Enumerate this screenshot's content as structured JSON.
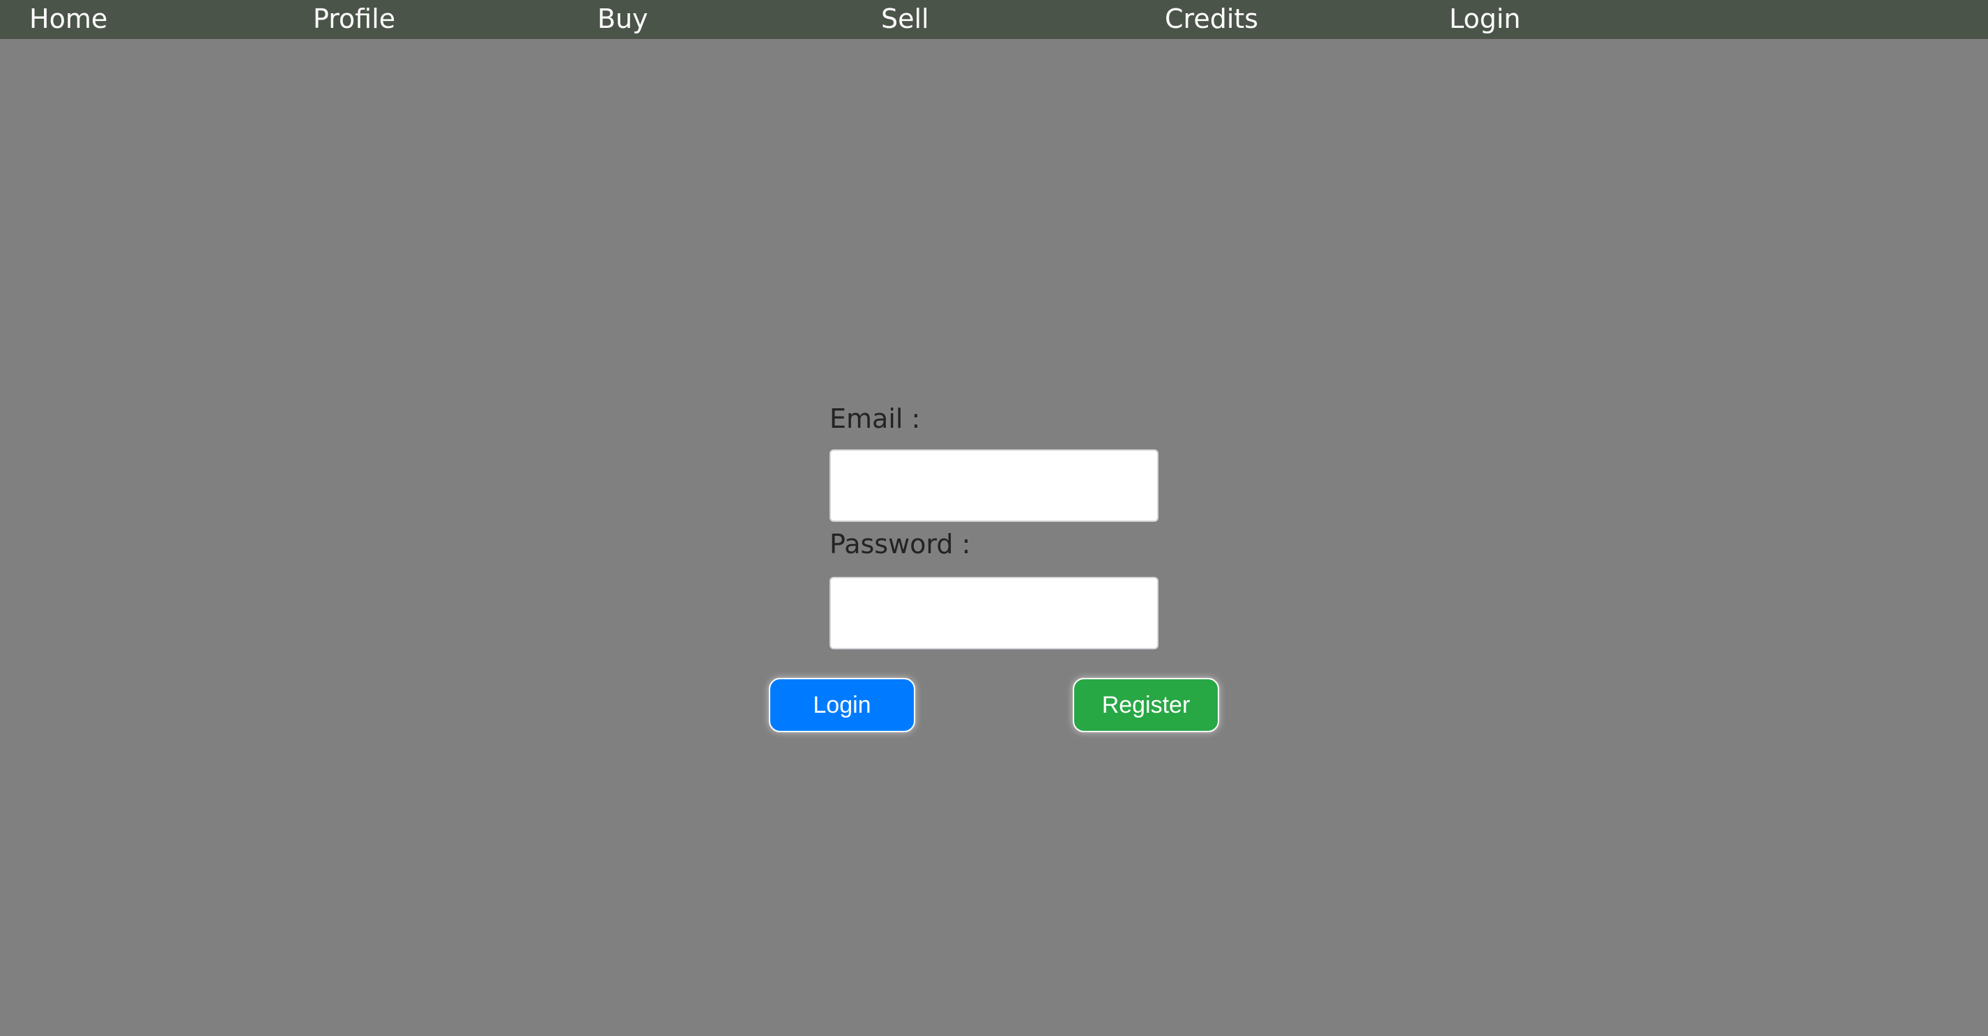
{
  "nav": {
    "items": [
      {
        "label": "Home"
      },
      {
        "label": "Profile"
      },
      {
        "label": "Buy"
      },
      {
        "label": "Sell"
      },
      {
        "label": "Credits"
      },
      {
        "label": "Login"
      }
    ]
  },
  "form": {
    "email_label": "Email :",
    "email_value": "",
    "password_label": "Password :",
    "password_value": "",
    "login_button": "Login",
    "register_button": "Register"
  },
  "colors": {
    "page_background": "#808080",
    "navbar_background": "#4b5449",
    "login_button": "#007bff",
    "register_button": "#28a745"
  }
}
